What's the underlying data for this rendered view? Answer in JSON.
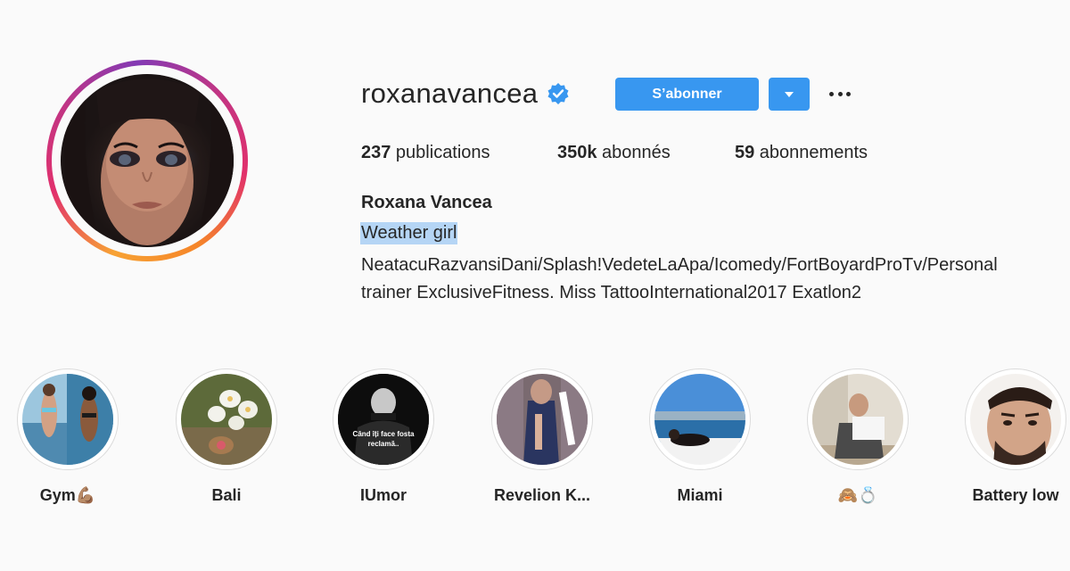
{
  "profile": {
    "username": "roxanavancea",
    "follow_label": "S’abonner",
    "full_name": "Roxana Vancea",
    "bio_line1": "Weather girl",
    "bio_line2": "NeatacuRazvansiDani/Splash!VedeteLaApa/Icomedy/FortBoyardProTv/Personal",
    "bio_line3": "trainer ExclusiveFitness. Miss TattooInternational2017 Exatlon2"
  },
  "stats": {
    "posts_count": "237",
    "posts_label": " publications",
    "followers_count": "350k",
    "followers_label": " abonnés",
    "following_count": "59",
    "following_label": " abonnements"
  },
  "highlights": [
    {
      "label": "Gym💪🏽"
    },
    {
      "label": "Bali"
    },
    {
      "label": "IUmor"
    },
    {
      "label": "Revelion K..."
    },
    {
      "label": "Miami"
    },
    {
      "label": "🙈💍"
    },
    {
      "label": "Battery low"
    }
  ],
  "highlight_texts": {
    "umor_caption": "Când îți face fosta reclamă.."
  },
  "colors": {
    "accent": "#3897f0",
    "verified": "#3897f0",
    "selection": "#b5d5f5"
  },
  "icons": [
    "verified-badge-icon",
    "caret-down-icon",
    "more-options-icon"
  ]
}
